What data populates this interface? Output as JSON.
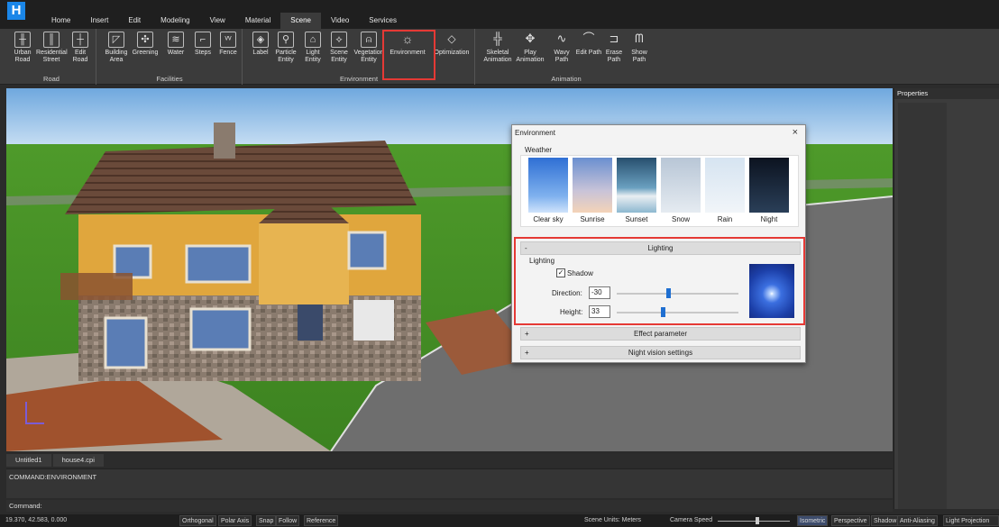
{
  "app": {
    "logo": "H"
  },
  "menu": {
    "tabs": [
      "Home",
      "Insert",
      "Edit",
      "Modeling",
      "View",
      "Material",
      "Scene",
      "Video",
      "Services"
    ],
    "active": "Scene"
  },
  "ribbon": {
    "road": {
      "title": "Road",
      "items": [
        "Urban Road",
        "Residential Street",
        "Edit Road"
      ]
    },
    "facilities": {
      "title": "Facilities",
      "items": [
        "Building Area",
        "Greening",
        "Water",
        "Steps",
        "Fence"
      ]
    },
    "environment": {
      "title": "Environment",
      "items": [
        "Label",
        "Particle Entity",
        "Light Entity",
        "Scene Entity",
        "Vegetation Entity",
        "Environment",
        "Optimization"
      ]
    },
    "animation": {
      "title": "Animation",
      "items": [
        "Skeletal Animation",
        "Play Animation",
        "Wavy Path",
        "Edit Path",
        "Erase Path",
        "Show Path"
      ]
    }
  },
  "properties": {
    "title": "Properties"
  },
  "documents": {
    "tabs": [
      "Untitled1",
      "house4.cpi"
    ]
  },
  "command": {
    "history": "COMMAND:ENVIRONMENT",
    "prompt": "Command:"
  },
  "status": {
    "coords": "19.370, 42.583, 0.000",
    "toggles": [
      "Orthogonal",
      "Polar Axis",
      "Snap",
      "Follow",
      "Reference"
    ],
    "units": "Scene Units: Meters",
    "camera_speed": "Camera Speed",
    "modes": [
      "Isometric",
      "Perspective",
      "Shadow",
      "Anti-Aliasing",
      "Light Projection"
    ]
  },
  "dialog": {
    "title": "Environment",
    "close": "×",
    "weather_label": "Weather",
    "weather": [
      "Clear sky",
      "Sunrise",
      "Sunset",
      "Snow",
      "Rain",
      "Night"
    ],
    "lighting_header": "Lighting",
    "lighting_label": "Lighting",
    "shadow_label": "Shadow",
    "shadow_checked": true,
    "direction_label": "Direction:",
    "direction_value": "-30",
    "height_label": "Height:",
    "height_value": "33",
    "effect_header": "Effect parameter",
    "night_header": "Night vision settings",
    "minus": "-",
    "plus": "+"
  },
  "colors": {
    "accent": "#1f6fd1",
    "highlight": "#e53935"
  }
}
